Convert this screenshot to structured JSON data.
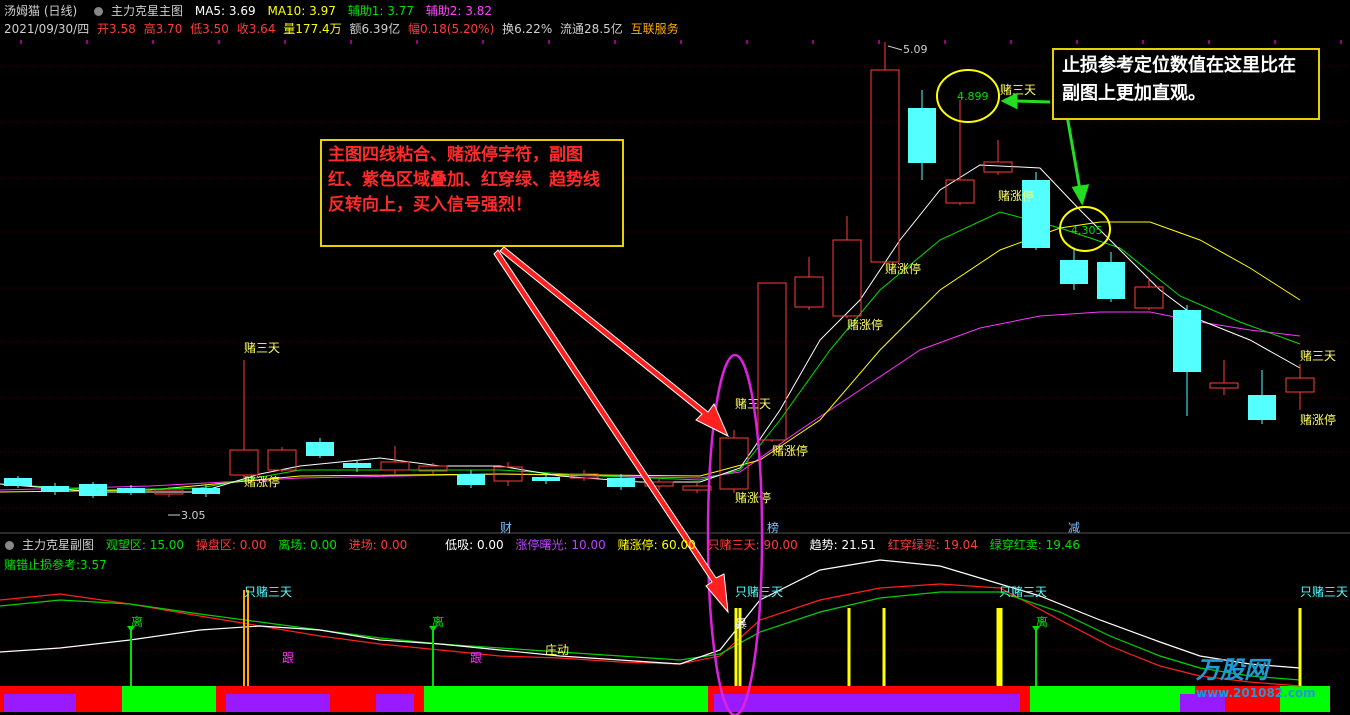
{
  "main": {
    "title": "汤姆猫 (日线)",
    "indicator": "主力克星主图",
    "ma5": "MA5: 3.69",
    "ma10": "MA10: 3.97",
    "aux1": "辅助1: 3.77",
    "aux2": "辅助2: 3.82",
    "date": "2021/09/30/四",
    "open": "开3.58",
    "high": "高3.70",
    "low": "低3.50",
    "close": "收3.64",
    "volume": "量177.4万",
    "amount": "额6.39亿",
    "amplitude": "幅0.18(5.20%)",
    "turnover": "换6.22%",
    "float": "流通28.5亿",
    "service": "互联服务",
    "high_mark": "5.09",
    "low_mark": "3.05",
    "circle_value_1": "4.899",
    "circle_value_2": "4.305",
    "label_bet3": "赌三天",
    "label_betlimit": "赌涨停",
    "markers": {
      "cai": "财",
      "bang": "榜",
      "jian": "减"
    }
  },
  "sub": {
    "indicator": "主力克星副图",
    "watch": "观望区: 15.00",
    "manip": "操盘区: 0.00",
    "leave": "离场: 0.00",
    "enter": "进场: 0.00",
    "low_absorb": "低吸: 0.00",
    "limit_light": "涨停曙光: 10.00",
    "bet_limit": "赌涨停: 60.00",
    "only_bet": "只赌三天: 90.00",
    "trend": "趋势: 21.51",
    "red_cross_green_buy": "红穿绿买: 19.04",
    "green_cross_red_sell": "绿穿红卖: 19.46",
    "stop_loss": "赌错止损参考:3.57",
    "label_only3": "只赌三天",
    "label_leave": "离",
    "label_follow": "跟",
    "label_zhuang": "庄动",
    "label_bao": "暴"
  },
  "callouts": {
    "left": "主图四线粘合、赌涨停字符，副图红、紫色区域叠加、红穿绿、趋势线反转向上，买入信号强烈！",
    "right": "止损参考定位数值在这里比在副图上更加直观。"
  },
  "watermark": {
    "brand": "万股网",
    "url": "www.201082.com"
  },
  "colors": {
    "up": "#ff3c3c",
    "down": "#54ffff",
    "ma5": "#ffffff",
    "ma10": "#ffff00",
    "green": "#00e000",
    "purple": "#ff33ff",
    "panel_red": "#ff0000",
    "panel_green": "#00ff00",
    "panel_purple": "#9a1aff"
  }
}
